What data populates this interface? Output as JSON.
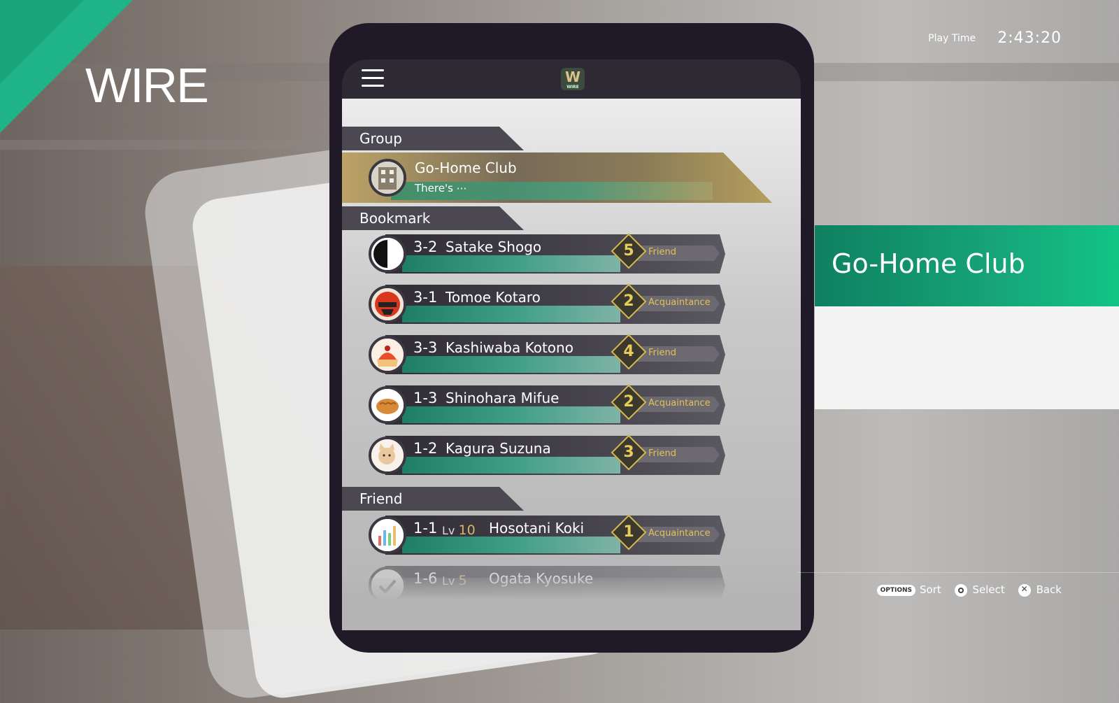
{
  "app_title": "WIRE",
  "play_time": {
    "label": "Play Time",
    "value": "2:43:20"
  },
  "phone": {
    "logo_letter": "W",
    "logo_sub": "WIRE",
    "sections": {
      "group": "Group",
      "bookmark": "Bookmark",
      "friend": "Friend"
    },
    "group": {
      "name": "Go-Home Club",
      "message": "There's ⋯"
    },
    "bookmarks": [
      {
        "class": "3-2",
        "name": "Satake Shogo",
        "level": "5",
        "relation": "Friend",
        "avatar": "half-moon-icon"
      },
      {
        "class": "3-1",
        "name": "Tomoe Kotaro",
        "level": "2",
        "relation": "Acquaintance",
        "avatar": "red-mask-icon"
      },
      {
        "class": "3-3",
        "name": "Kashiwaba Kotono",
        "level": "4",
        "relation": "Friend",
        "avatar": "cake-icon"
      },
      {
        "class": "1-3",
        "name": "Shinohara Mifue",
        "level": "2",
        "relation": "Acquaintance",
        "avatar": "bread-icon"
      },
      {
        "class": "1-2",
        "name": "Kagura Suzuna",
        "level": "3",
        "relation": "Friend",
        "avatar": "cat-icon"
      }
    ],
    "friends": [
      {
        "class": "1-1",
        "lv_label": "Lv",
        "lv": "10",
        "name": "Hosotani Koki",
        "level": "1",
        "relation": "Acquaintance",
        "avatar": "bar-chart-icon"
      },
      {
        "class": "1-6",
        "lv_label": "Lv",
        "lv": "5",
        "name": "Ogata Kyosuke",
        "level": "",
        "relation": "",
        "avatar": "check-icon"
      }
    ]
  },
  "detail": {
    "title": "Go-Home Club"
  },
  "hints": {
    "options": "OPTIONS",
    "sort": "Sort",
    "select": "Select",
    "back": "Back"
  },
  "colors": {
    "accent": "#16a578",
    "gold": "#d5b950"
  }
}
